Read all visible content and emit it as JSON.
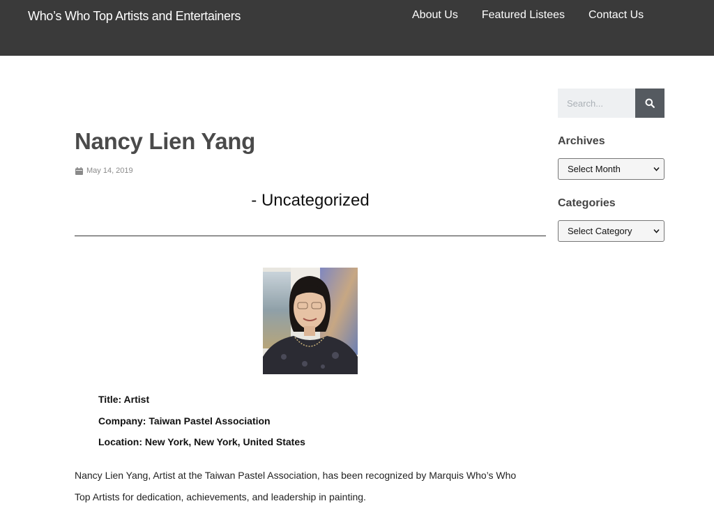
{
  "header": {
    "site_title": "Who’s Who Top Artists and Entertainers",
    "nav": [
      {
        "label": "About Us"
      },
      {
        "label": "Featured Listees"
      },
      {
        "label": "Contact Us"
      }
    ],
    "background": "#3a3a3a"
  },
  "post": {
    "title": "Nancy Lien Yang",
    "date": "May 14, 2019",
    "category_line": "- Uncategorized",
    "facts": [
      {
        "text": "Title: Artist"
      },
      {
        "text": "Company: Taiwan Pastel Association"
      },
      {
        "text": "Location: New York, New York, United States"
      }
    ],
    "bio": "Nancy Lien Yang, Artist at the Taiwan Pastel Association, has been recognized by Marquis Who’s Who Top Artists for dedication, achievements, and leadership in painting."
  },
  "sidebar": {
    "search": {
      "placeholder": "Search...",
      "icon": "search-icon"
    },
    "archives": {
      "heading": "Archives",
      "selected": "Select Month"
    },
    "categories": {
      "heading": "Categories",
      "selected": "Select Category"
    }
  },
  "colors": {
    "header_bg": "#3a3a3a",
    "search_button": "#555a60",
    "search_bg": "#eef0f2",
    "title_text": "#4a4a4a"
  }
}
